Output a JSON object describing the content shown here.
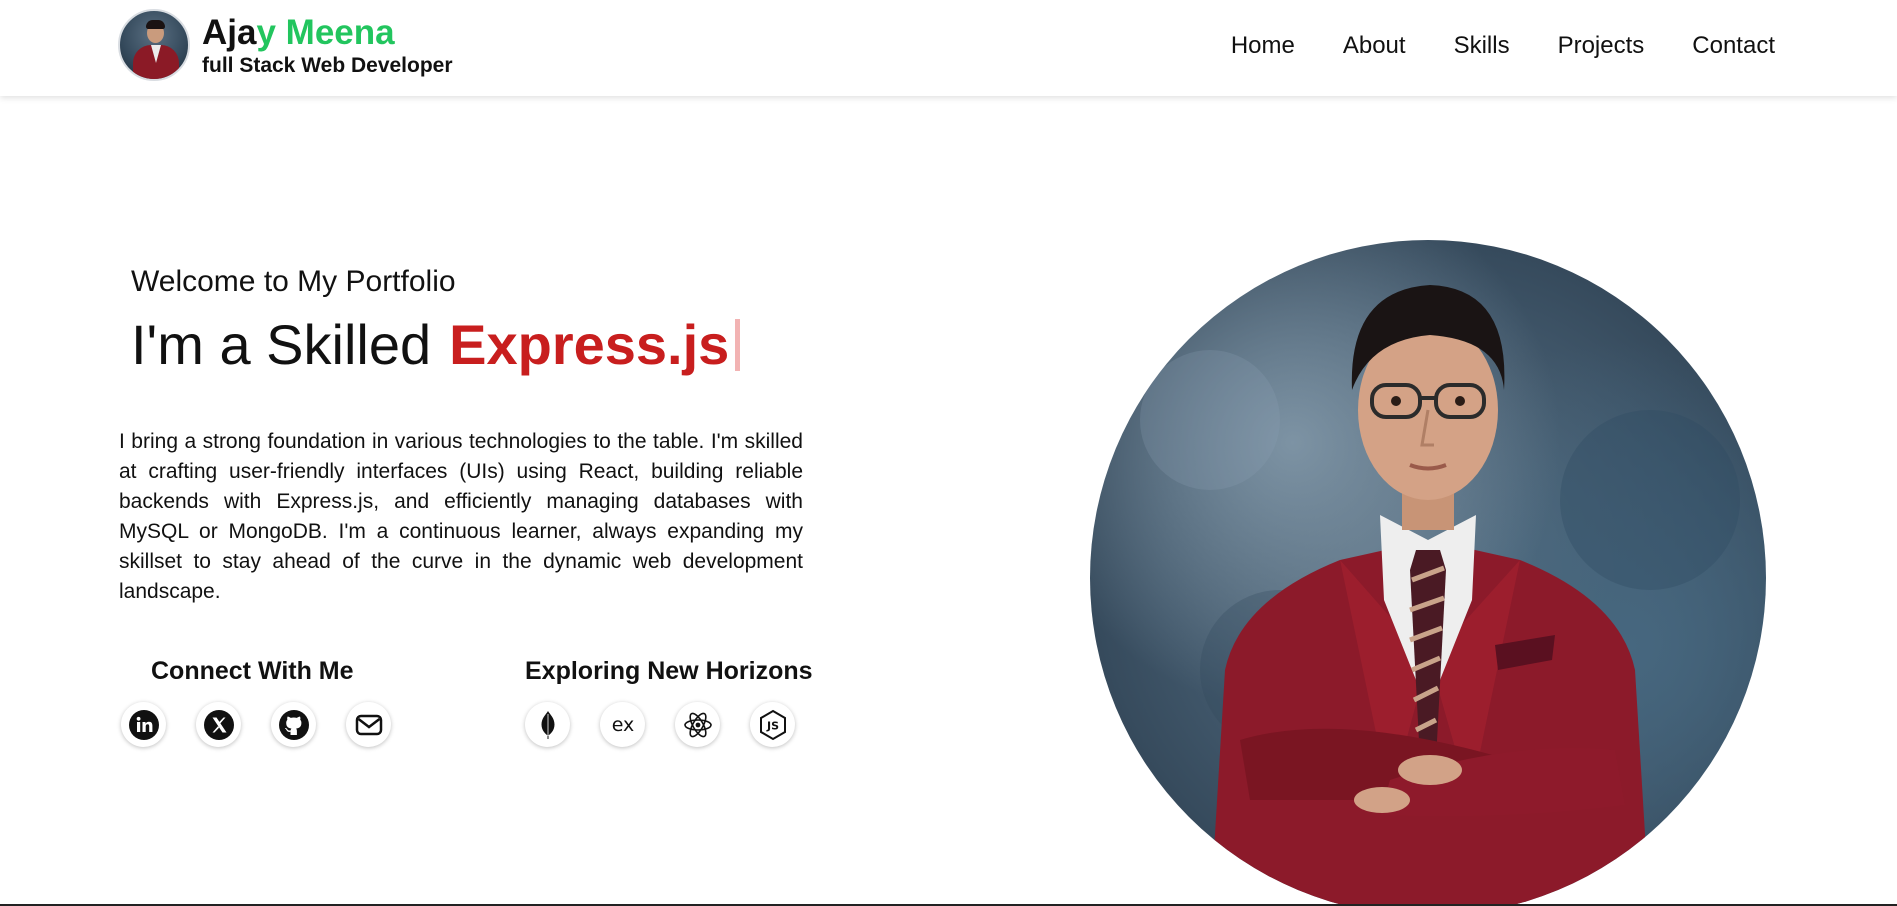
{
  "header": {
    "name_part1": "Aja",
    "name_part2": "y Meena",
    "role": "full Stack Web Developer",
    "nav": [
      "Home",
      "About",
      "Skills",
      "Projects",
      "Contact"
    ]
  },
  "hero": {
    "welcome": "Welcome to My Portfolio",
    "headline_prefix": "I'm a Skilled",
    "headline_tech": "Express.js",
    "bio": "I bring a strong foundation in various technologies to the table. I'm skilled at crafting user-friendly interfaces (UIs) using React, building reliable backends with Express.js, and efficiently managing databases with MySQL or MongoDB. I'm a continuous learner, always expanding my skillset to stay ahead of the curve in the dynamic web development landscape."
  },
  "connect": {
    "title": "Connect With Me",
    "icons": [
      "linkedin-icon",
      "x-twitter-icon",
      "github-icon",
      "mail-icon"
    ]
  },
  "explore": {
    "title": "Exploring New Horizons",
    "icons": [
      "mongodb-icon",
      "express-icon",
      "react-icon",
      "nodejs-icon"
    ]
  },
  "colors": {
    "brand_green": "#22c55e",
    "accent_red": "#c81e1e",
    "text": "#111111"
  }
}
